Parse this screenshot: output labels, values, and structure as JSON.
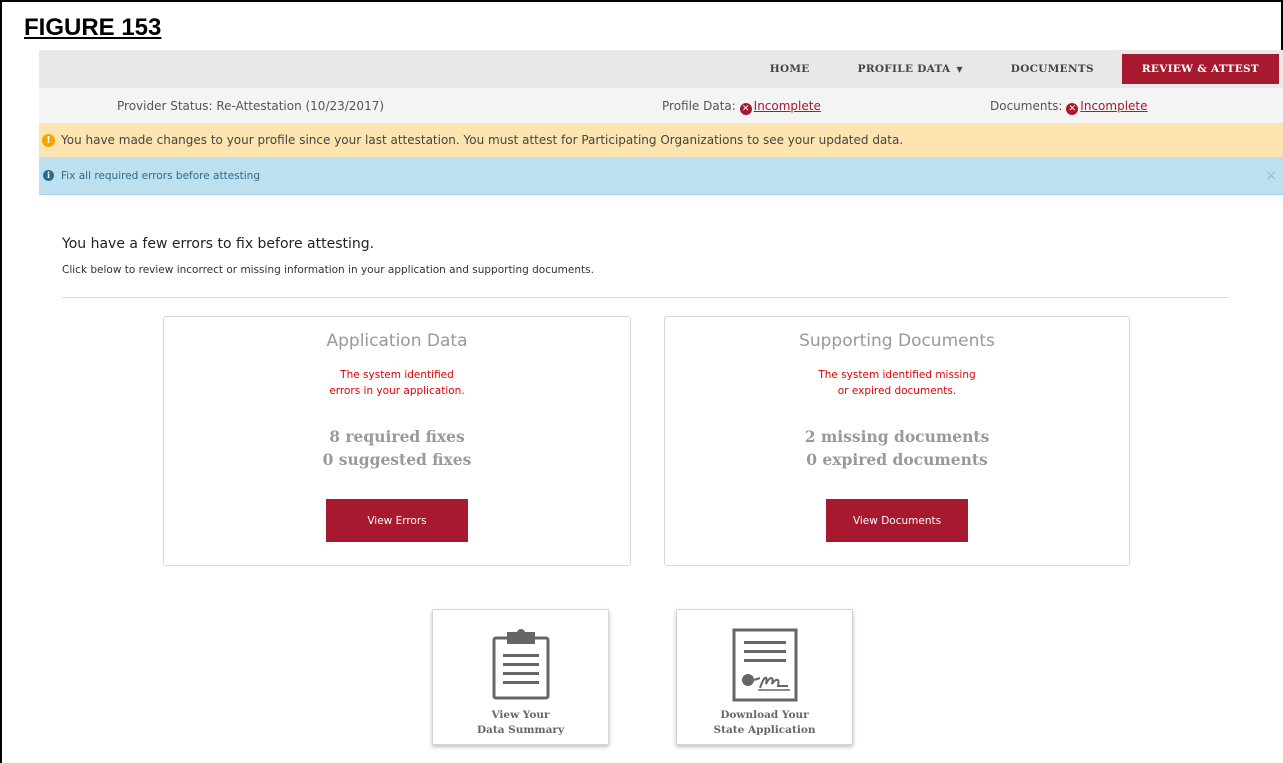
{
  "figure_label": "FIGURE 153",
  "nav": {
    "home": "HOME",
    "profile_data": "PROFILE DATA",
    "documents": "DOCUMENTS",
    "review_attest": "REVIEW & ATTEST"
  },
  "status": {
    "provider_label": "Provider Status:",
    "provider_value": "Re-Attestation (10/23/2017)",
    "profile_label": "Profile Data:",
    "profile_value": "Incomplete",
    "documents_label": "Documents:",
    "documents_value": "Incomplete"
  },
  "alerts": {
    "warning": "You have made changes to your profile since your last attestation. You must attest for Participating Organizations to see your updated data.",
    "info": "Fix all required errors before attesting",
    "close": "×"
  },
  "main": {
    "heading": "You have a few errors to fix before attesting.",
    "subheading": "Click below to review incorrect or missing information in your application and supporting documents."
  },
  "cards": {
    "application": {
      "title": "Application Data",
      "msg_line1": "The system identified",
      "msg_line2": "errors in your application.",
      "count1": "8 required fixes",
      "count2": "0 suggested fixes",
      "button": "View Errors"
    },
    "documents": {
      "title": "Supporting Documents",
      "msg_line1": "The system identified missing",
      "msg_line2": "or expired documents.",
      "count1": "2 missing documents",
      "count2": "0 expired documents",
      "button": "View Documents"
    }
  },
  "tiles": {
    "summary_line1": "View Your",
    "summary_line2": "Data Summary",
    "download_line1": "Download Your",
    "download_line2": "State Application"
  },
  "colors": {
    "brand": "#a6192e",
    "warning_bg": "#fce5b0",
    "info_bg": "#bde0f0",
    "error_text": "#e00000"
  }
}
